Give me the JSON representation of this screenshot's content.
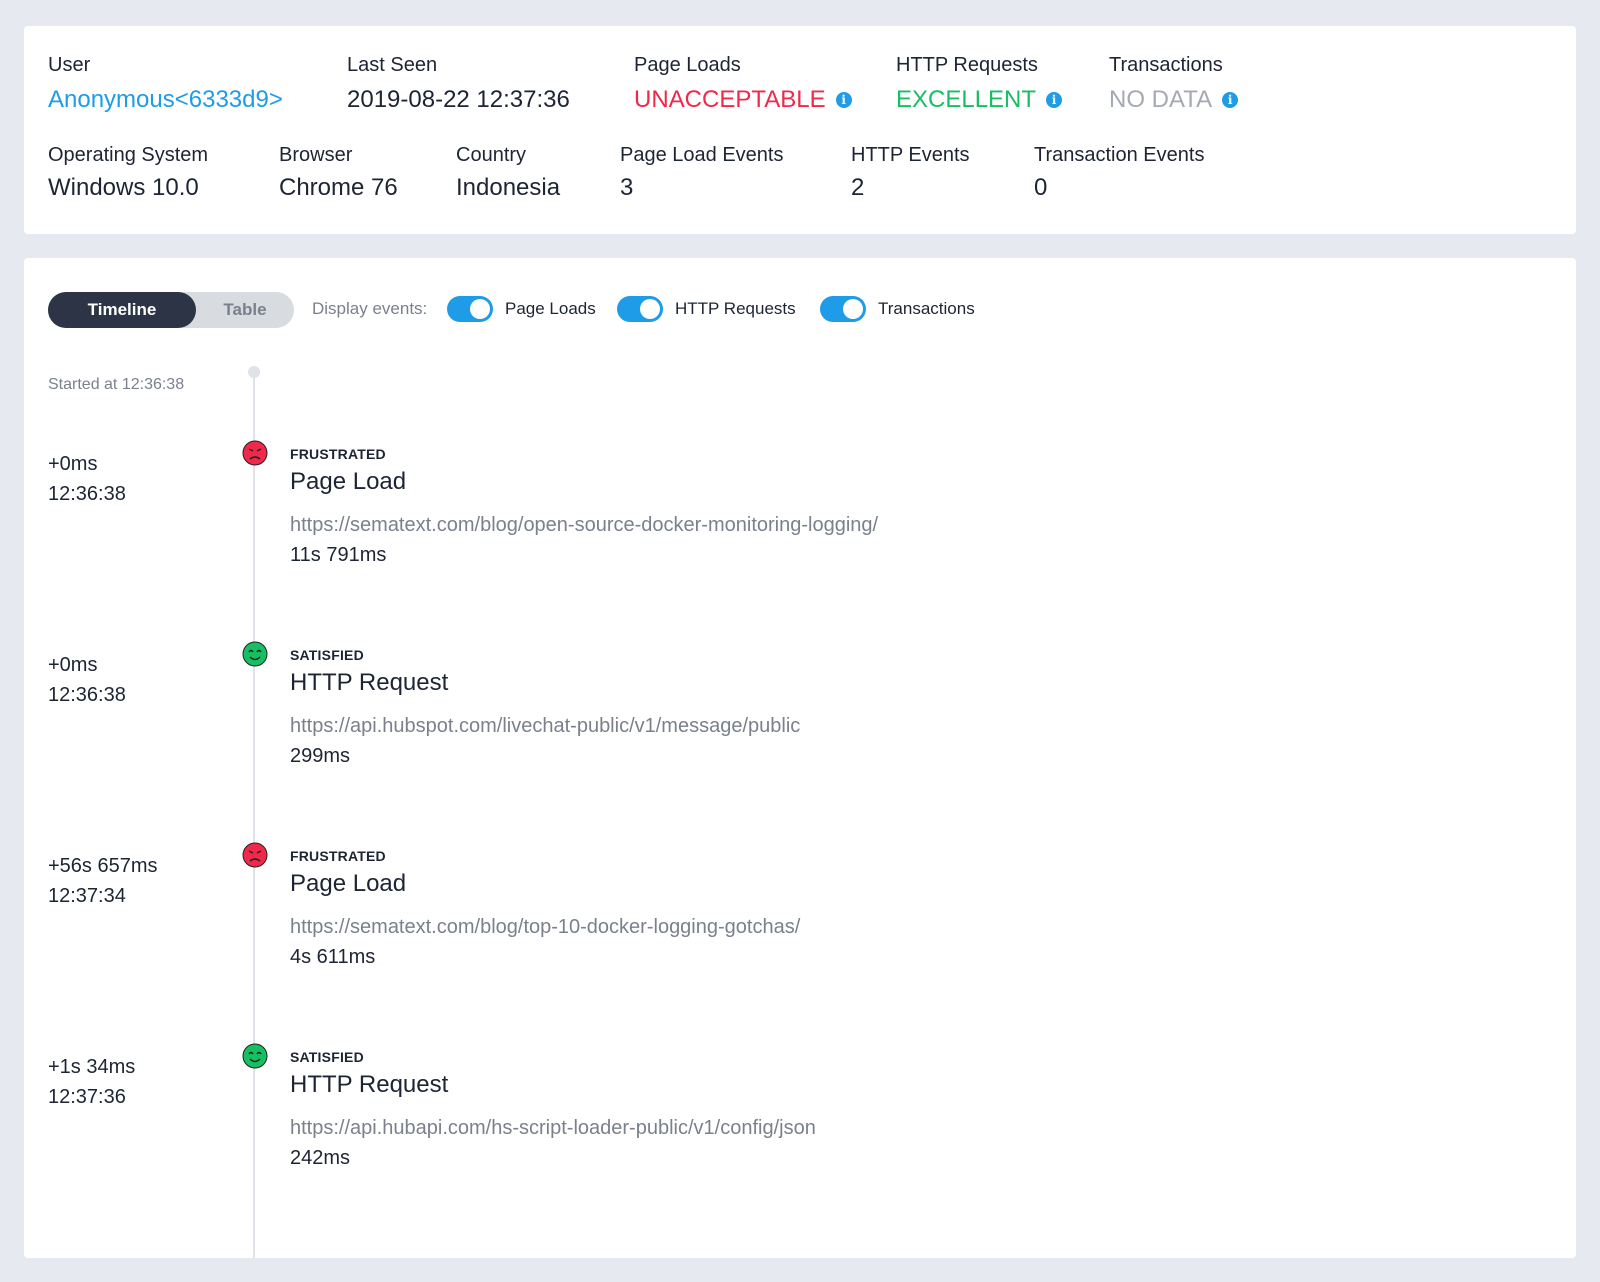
{
  "summary": {
    "row1": [
      {
        "label": "User",
        "value": "Anonymous<6333d9>",
        "style": "link",
        "info": false
      },
      {
        "label": "Last Seen",
        "value": "2019-08-22 12:37:36",
        "style": "plain",
        "info": false
      },
      {
        "label": "Page Loads",
        "value": "UNACCEPTABLE",
        "style": "bad",
        "info": true
      },
      {
        "label": "HTTP Requests",
        "value": "EXCELLENT",
        "style": "good",
        "info": true
      },
      {
        "label": "Transactions",
        "value": "NO DATA",
        "style": "nodata",
        "info": true
      }
    ],
    "row2": [
      {
        "label": "Operating System",
        "value": "Windows 10.0"
      },
      {
        "label": "Browser",
        "value": "Chrome 76"
      },
      {
        "label": "Country",
        "value": "Indonesia"
      },
      {
        "label": "Page Load Events",
        "value": "3"
      },
      {
        "label": "HTTP Events",
        "value": "2"
      },
      {
        "label": "Transaction Events",
        "value": "0"
      }
    ]
  },
  "view_toggle": {
    "active": "Timeline",
    "inactive": "Table"
  },
  "display_events": {
    "label": "Display events:",
    "toggles": [
      {
        "label": "Page Loads",
        "on": true
      },
      {
        "label": "HTTP Requests",
        "on": true
      },
      {
        "label": "Transactions",
        "on": true
      }
    ]
  },
  "timeline": {
    "started": "Started at 12:36:38",
    "events": [
      {
        "offset": "+0ms",
        "time": "12:36:38",
        "status": "FRUSTRATED",
        "title": "Page Load",
        "url": "https://sematext.com/blog/open-source-docker-monitoring-logging/",
        "duration": "11s 791ms",
        "mood": "frustrated"
      },
      {
        "offset": "+0ms",
        "time": "12:36:38",
        "status": "SATISFIED",
        "title": "HTTP Request",
        "url": "https://api.hubspot.com/livechat-public/v1/message/public",
        "duration": "299ms",
        "mood": "satisfied"
      },
      {
        "offset": "+56s 657ms",
        "time": "12:37:34",
        "status": "FRUSTRATED",
        "title": "Page Load",
        "url": "https://sematext.com/blog/top-10-docker-logging-gotchas/",
        "duration": "4s 611ms",
        "mood": "frustrated"
      },
      {
        "offset": "+1s 34ms",
        "time": "12:37:36",
        "status": "SATISFIED",
        "title": "HTTP Request",
        "url": "https://api.hubapi.com/hs-script-loader-public/v1/config/json",
        "duration": "242ms",
        "mood": "satisfied"
      }
    ]
  },
  "colors": {
    "accent": "#1e9ce8",
    "bad": "#f0284a",
    "good": "#17bf63",
    "nodata": "#a4a9b3"
  }
}
